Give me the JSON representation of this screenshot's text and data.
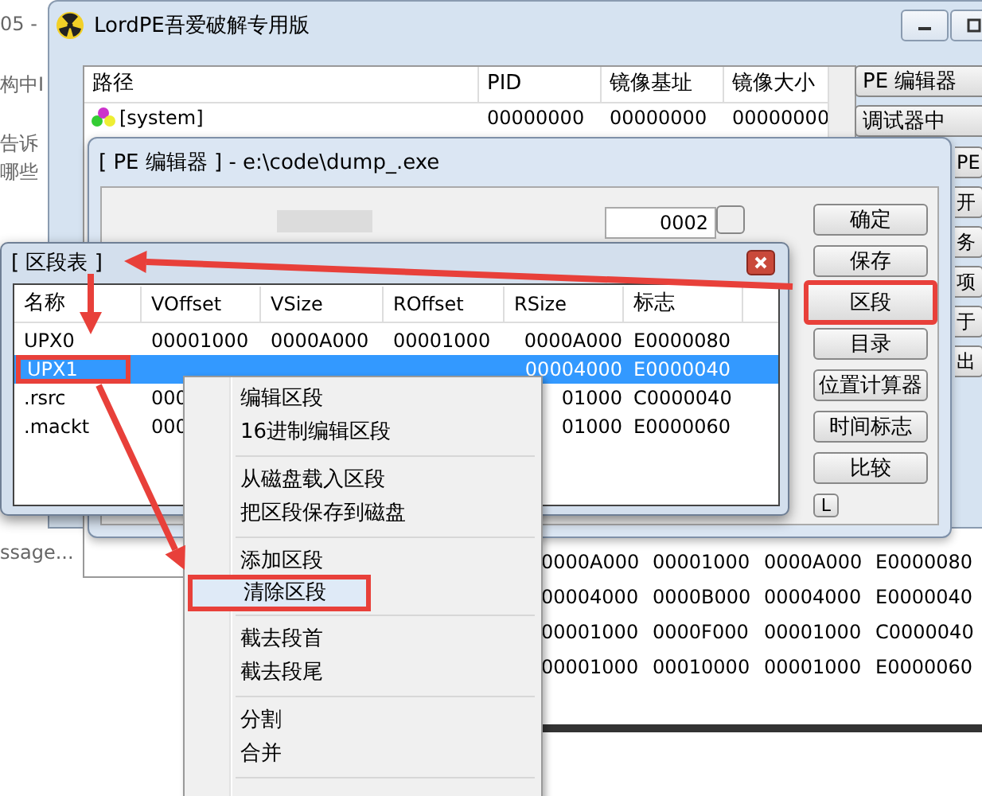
{
  "background_page": {
    "texts": [
      "05 -",
      "构中I",
      "告诉",
      "哪些",
      "ssage..."
    ]
  },
  "main_window": {
    "title": "LordPE吾爱破解专用版",
    "process_list": {
      "columns": [
        "路径",
        "PID",
        "镜像基址",
        "镜像大小"
      ],
      "rows": [
        {
          "cells": [
            "[system]",
            "00000000",
            "00000000",
            "00000000"
          ]
        }
      ]
    },
    "side_buttons": [
      "PE 编辑器",
      "调试器中",
      "PE",
      "开",
      "务",
      "项",
      "于",
      "出"
    ]
  },
  "pe_editor": {
    "title": "[ PE 编辑器 ] - e:\\code\\dump_.exe",
    "field_value": "0002",
    "buttons": [
      {
        "label": "确定",
        "highlighted": false
      },
      {
        "label": "保存",
        "highlighted": false
      },
      {
        "label": "区段",
        "highlighted": true
      },
      {
        "label": "目录",
        "highlighted": false
      },
      {
        "label": "位置计算器",
        "highlighted": false
      },
      {
        "label": "时间标志",
        "highlighted": false
      },
      {
        "label": "比较",
        "highlighted": false
      },
      {
        "label": "L",
        "highlighted": false
      }
    ]
  },
  "section_table": {
    "title": "[ 区段表 ]",
    "columns": [
      "名称",
      "VOffset",
      "VSize",
      "ROffset",
      "RSize",
      "标志"
    ],
    "rows": [
      {
        "cells": [
          "UPX0",
          "00001000",
          "0000A000",
          "00001000",
          "0000A000",
          "E0000080"
        ],
        "selected": false,
        "highlighted": false
      },
      {
        "cells": [
          "UPX1",
          "",
          "",
          "",
          "00004000",
          "E0000040"
        ],
        "selected": true,
        "highlighted": true
      },
      {
        "cells": [
          ".rsrc",
          "000",
          "",
          "",
          "01000",
          "C0000040"
        ],
        "selected": false,
        "highlighted": false
      },
      {
        "cells": [
          ".mackt",
          "000",
          "",
          "",
          "01000",
          "E0000060"
        ],
        "selected": false,
        "highlighted": false
      }
    ]
  },
  "context_menu": {
    "groups": [
      [
        {
          "label": "编辑区段",
          "hovered": false,
          "highlighted": false
        },
        {
          "label": "16进制编辑区段",
          "hovered": false,
          "highlighted": false
        }
      ],
      [
        {
          "label": "从磁盘载入区段",
          "hovered": false,
          "highlighted": false
        },
        {
          "label": "把区段保存到磁盘",
          "hovered": false,
          "highlighted": false
        }
      ],
      [
        {
          "label": "添加区段",
          "hovered": false,
          "highlighted": false
        },
        {
          "label": "清除区段",
          "hovered": true,
          "highlighted": true
        }
      ],
      [
        {
          "label": "截去段首",
          "hovered": false,
          "highlighted": false
        },
        {
          "label": "截去段尾",
          "hovered": false,
          "highlighted": false
        }
      ],
      [
        {
          "label": "分割",
          "hovered": false,
          "highlighted": false
        },
        {
          "label": "合并",
          "hovered": false,
          "highlighted": false
        }
      ]
    ]
  },
  "background_table": {
    "rows": [
      [
        "0000A000",
        "00001000",
        "0000A000",
        "E0000080"
      ],
      [
        "00004000",
        "0000B000",
        "00004000",
        "E0000040"
      ],
      [
        "00001000",
        "0000F000",
        "00001000",
        "C0000040"
      ],
      [
        "00001000",
        "00010000",
        "00001000",
        "E0000060"
      ]
    ]
  }
}
